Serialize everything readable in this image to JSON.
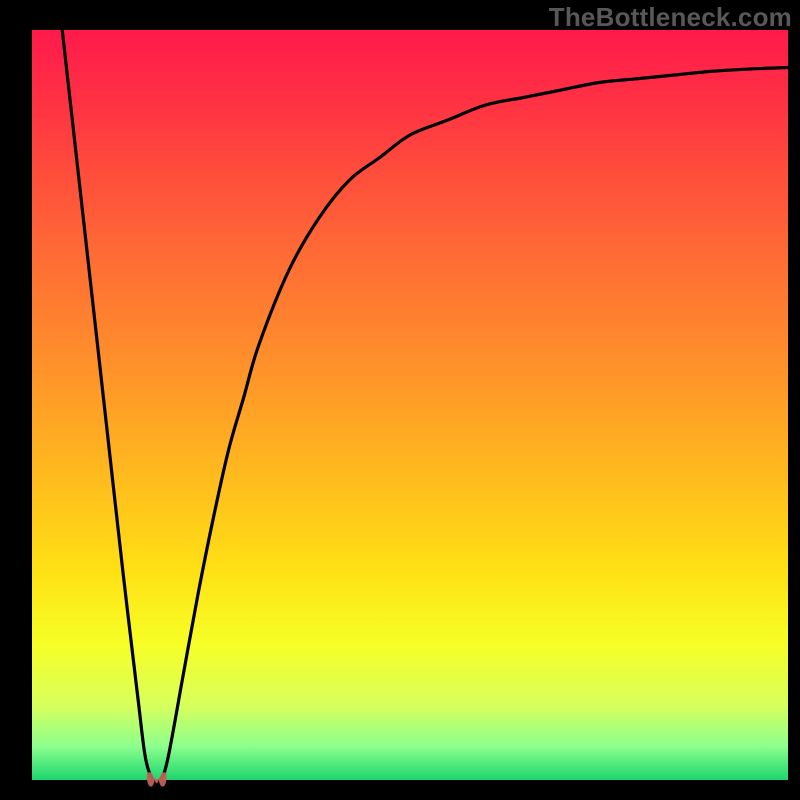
{
  "watermark": "TheBottleneck.com",
  "colors": {
    "frame": "#000000",
    "curveStroke": "#000000",
    "markerFill": "#c06058",
    "gradientStops": [
      {
        "offset": 0.0,
        "color": "#ff1a4b"
      },
      {
        "offset": 0.08,
        "color": "#ff2d45"
      },
      {
        "offset": 0.18,
        "color": "#ff4a3c"
      },
      {
        "offset": 0.3,
        "color": "#ff6b35"
      },
      {
        "offset": 0.44,
        "color": "#ff8f2b"
      },
      {
        "offset": 0.58,
        "color": "#ffb61f"
      },
      {
        "offset": 0.72,
        "color": "#ffe014"
      },
      {
        "offset": 0.82,
        "color": "#f6ff27"
      },
      {
        "offset": 0.9,
        "color": "#d8ff5b"
      },
      {
        "offset": 0.955,
        "color": "#8dff8d"
      },
      {
        "offset": 1.0,
        "color": "#1cd66e"
      }
    ]
  },
  "layout": {
    "outerSize": 800,
    "innerPadLeft": 32,
    "innerPadRight": 12,
    "innerPadTop": 30,
    "innerPadBottom": 20
  },
  "chart_data": {
    "type": "line",
    "title": "",
    "xlabel": "",
    "ylabel": "",
    "categories": null,
    "x": [
      0.04,
      0.06,
      0.08,
      0.1,
      0.12,
      0.14,
      0.15,
      0.16,
      0.17,
      0.18,
      0.2,
      0.22,
      0.24,
      0.26,
      0.28,
      0.3,
      0.34,
      0.38,
      0.42,
      0.46,
      0.5,
      0.55,
      0.6,
      0.65,
      0.7,
      0.75,
      0.8,
      0.85,
      0.9,
      0.95,
      1.0
    ],
    "values": [
      1.0,
      0.82,
      0.64,
      0.46,
      0.28,
      0.11,
      0.03,
      0.0,
      0.0,
      0.03,
      0.14,
      0.25,
      0.35,
      0.44,
      0.51,
      0.58,
      0.68,
      0.75,
      0.8,
      0.83,
      0.86,
      0.88,
      0.9,
      0.91,
      0.92,
      0.93,
      0.935,
      0.94,
      0.945,
      0.948,
      0.95
    ],
    "series": [
      {
        "name": "main",
        "x_ref": "x",
        "y_ref": "values"
      }
    ],
    "marker": {
      "x": 0.165,
      "y": 0.0,
      "shape": "u-blob"
    },
    "xlim": [
      0,
      1
    ],
    "ylim": [
      0,
      1
    ],
    "notes": "x and y are normalized to the plotting frame because the source image has no visible axis ticks or numeric labels; values are gridline-free estimates."
  }
}
